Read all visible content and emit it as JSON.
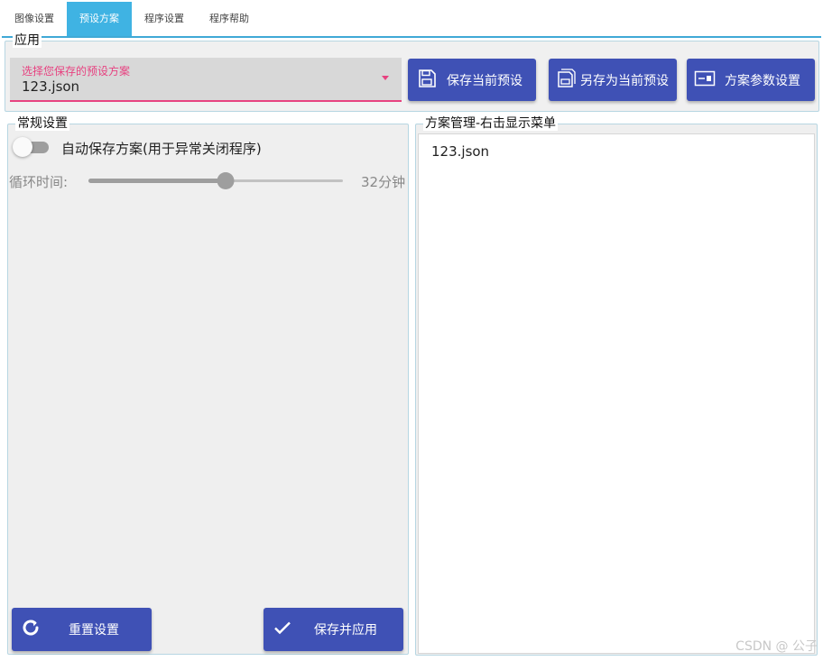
{
  "tabs": [
    {
      "label": "图像设置"
    },
    {
      "label": "预设方案"
    },
    {
      "label": "程序设置"
    },
    {
      "label": "程序帮助"
    }
  ],
  "active_tab": "预设方案",
  "apply_group": {
    "legend": "应用",
    "select": {
      "placeholder": "选择您保存的预设方案",
      "value": "123.json"
    },
    "buttons": {
      "save_current": "保存当前预设",
      "save_as": "另存为当前预设",
      "params": "方案参数设置"
    }
  },
  "general_group": {
    "legend": "常规设置",
    "auto_save": {
      "label": "自动保存方案(用于异常关闭程序)",
      "enabled": false
    },
    "cycle": {
      "label": "循环时间:",
      "value_text": "32分钟",
      "fraction": 0.54
    },
    "buttons": {
      "reset": "重置设置",
      "save_apply": "保存并应用"
    }
  },
  "manager_group": {
    "legend": "方案管理-右击显示菜单",
    "items": [
      "123.json"
    ]
  },
  "watermark": "CSDN @ 公子",
  "colors": {
    "accent": "#3fb3e3",
    "primary": "#3f51b5",
    "select_accent": "#e74280"
  }
}
